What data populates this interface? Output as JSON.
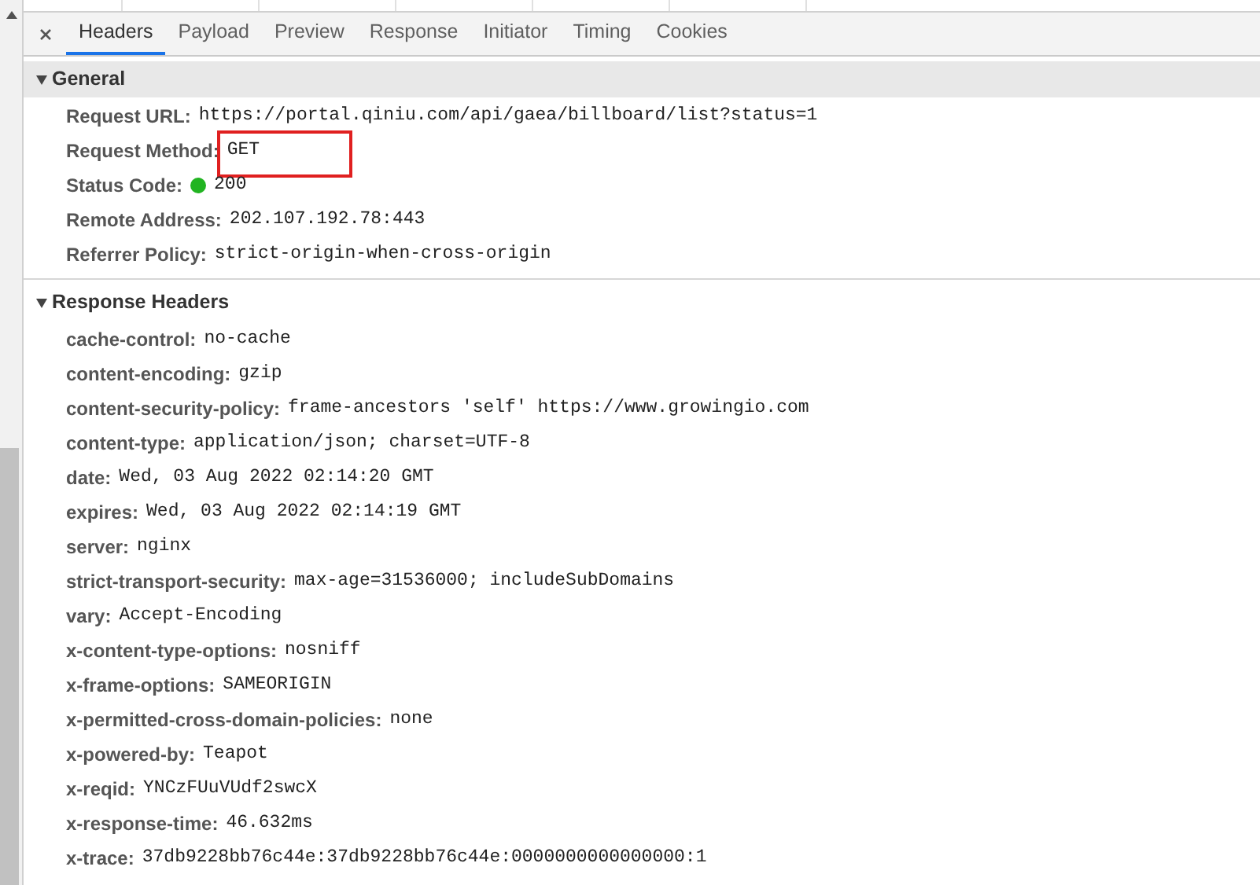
{
  "tabs": [
    {
      "label": "Headers",
      "selected": true
    },
    {
      "label": "Payload",
      "selected": false
    },
    {
      "label": "Preview",
      "selected": false
    },
    {
      "label": "Response",
      "selected": false
    },
    {
      "label": "Initiator",
      "selected": false
    },
    {
      "label": "Timing",
      "selected": false
    },
    {
      "label": "Cookies",
      "selected": false
    }
  ],
  "sections": [
    {
      "title": "General",
      "expanded": true,
      "rows": [
        {
          "name": "Request URL:",
          "value": "https://portal.qiniu.com/api/gaea/billboard/list?status=1"
        },
        {
          "name": "Request Method:",
          "value": "GET",
          "highlighted": true
        },
        {
          "name": "Status Code:",
          "value": "200",
          "color": "#22b422"
        },
        {
          "name": "Remote Address:",
          "value": "202.107.192.78:443"
        },
        {
          "name": "Referrer Policy:",
          "value": "strict-origin-when-cross-origin"
        }
      ]
    },
    {
      "title": "Response Headers",
      "expanded": true,
      "rows": [
        {
          "name": "cache-control:",
          "value": "no-cache"
        },
        {
          "name": "content-encoding:",
          "value": "gzip"
        },
        {
          "name": "content-security-policy:",
          "value": "frame-ancestors 'self' https://www.growingio.com"
        },
        {
          "name": "content-type:",
          "value": "application/json; charset=UTF-8"
        },
        {
          "name": "date:",
          "value": "Wed, 03 Aug 2022 02:14:20 GMT"
        },
        {
          "name": "expires:",
          "value": "Wed, 03 Aug 2022 02:14:19 GMT"
        },
        {
          "name": "server:",
          "value": "nginx"
        },
        {
          "name": "strict-transport-security:",
          "value": "max-age=31536000; includeSubDomains"
        },
        {
          "name": "vary:",
          "value": "Accept-Encoding"
        },
        {
          "name": "x-content-type-options:",
          "value": "nosniff"
        },
        {
          "name": "x-frame-options:",
          "value": "SAMEORIGIN"
        },
        {
          "name": "x-permitted-cross-domain-policies:",
          "value": "none"
        },
        {
          "name": "x-powered-by:",
          "value": "Teapot"
        },
        {
          "name": "x-reqid:",
          "value": "YNCzFUuVUdf2swcX"
        },
        {
          "name": "x-response-time:",
          "value": "46.632ms"
        },
        {
          "name": "x-trace:",
          "value": "37db9228bb76c44e:37db9228bb76c44e:0000000000000000:1"
        }
      ]
    }
  ]
}
